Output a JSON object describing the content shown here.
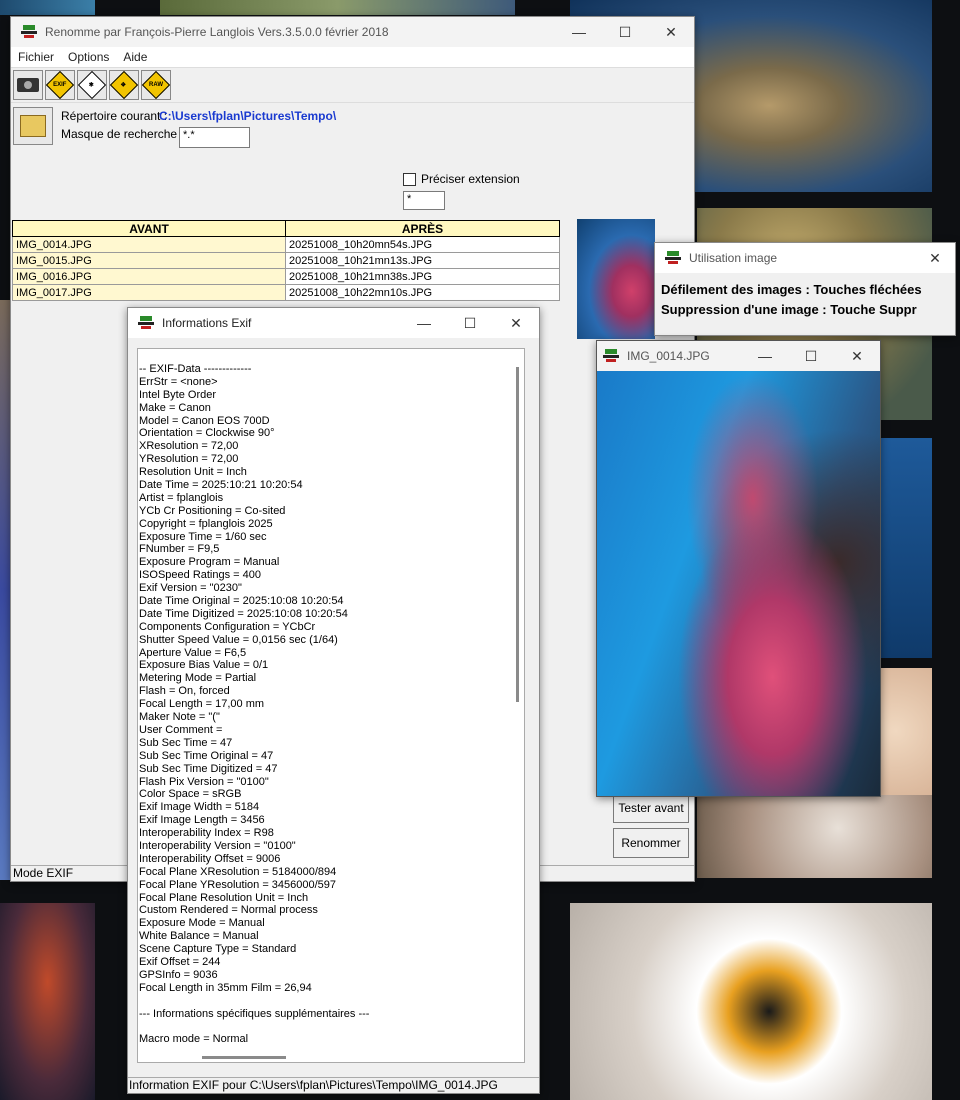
{
  "main": {
    "title": "Renomme par François-Pierre Langlois Vers.3.5.0.0 février 2018",
    "menus": [
      "Fichier",
      "Options",
      "Aide"
    ],
    "toolbar": {
      "exif_label": "EXIF",
      "raw_label": "RAW"
    },
    "dir_label": "Répertoire courant :",
    "dir_value": "C:\\Users\\fplan\\Pictures\\Tempo\\",
    "mask_label": "Masque de recherche :",
    "mask_value": "*.*",
    "ext_label": "Préciser extension",
    "ext_value": "*",
    "table": {
      "headers": [
        "AVANT",
        "APRÈS"
      ],
      "rows": [
        [
          "IMG_0014.JPG",
          "20251008_10h20mn54s.JPG"
        ],
        [
          "IMG_0015.JPG",
          "20251008_10h21mn13s.JPG"
        ],
        [
          "IMG_0016.JPG",
          "20251008_10h21mn38s.JPG"
        ],
        [
          "IMG_0017.JPG",
          "20251008_10h22mn10s.JPG"
        ]
      ]
    },
    "test_button": "Tester avant",
    "rename_button": "Renommer",
    "status": "Mode EXIF"
  },
  "exif": {
    "title": "Informations Exif",
    "lines": [
      "-- EXIF-Data -------------",
      "ErrStr = <none>",
      "Intel Byte Order",
      "Make = Canon",
      "Model = Canon EOS 700D",
      "Orientation = Clockwise 90°",
      "XResolution = 72,00",
      "YResolution = 72,00",
      "Resolution Unit = Inch",
      "Date Time = 2025:10:21 10:20:54",
      "Artist = fplanglois",
      "YCb Cr Positioning = Co-sited",
      "Copyright = fplanglois 2025",
      "Exposure Time = 1/60 sec",
      "FNumber = F9,5",
      "Exposure Program = Manual",
      "ISOSpeed Ratings = 400",
      "Exif Version = \"0230\"",
      "Date Time Original = 2025:10:08 10:20:54",
      "Date Time Digitized = 2025:10:08 10:20:54",
      "Components Configuration = YCbCr",
      "Shutter Speed Value = 0,0156 sec (1/64)",
      "Aperture Value = F6,5",
      "Exposure Bias Value = 0/1",
      "Metering Mode = Partial",
      "Flash = On, forced",
      "Focal Length = 17,00 mm",
      "Maker Note = \"(\"",
      "User Comment =",
      "Sub Sec Time = 47",
      "Sub Sec Time Original = 47",
      "Sub Sec Time Digitized = 47",
      "Flash Pix Version = \"0100\"",
      "Color Space = sRGB",
      "Exif Image Width = 5184",
      "Exif Image Length = 3456",
      "Interoperability Index = R98",
      "Interoperability Version = \"0100\"",
      "Interoperability Offset = 9006",
      "Focal Plane XResolution = 5184000/894",
      "Focal Plane YResolution = 3456000/597",
      "Focal Plane Resolution Unit = Inch",
      "Custom Rendered = Normal process",
      "Exposure Mode = Manual",
      "White Balance = Manual",
      "Scene Capture Type = Standard",
      "Exif Offset = 244",
      "GPSInfo = 9036",
      "Focal Length in 35mm Film = 26,94",
      "",
      "--- Informations spécifiques supplémentaires ---",
      "",
      "Macro mode = Normal"
    ],
    "status": "Information EXIF pour C:\\Users\\fplan\\Pictures\\Tempo\\IMG_0014.JPG"
  },
  "usage": {
    "title": "Utilisation image",
    "line1": "Défilement des images : Touches fléchées",
    "line2": "Suppression d'une image : Touche Suppr"
  },
  "image_window": {
    "title": "IMG_0014.JPG"
  },
  "window_controls": {
    "minimize": "—",
    "maximize": "☐",
    "close": "✕"
  }
}
